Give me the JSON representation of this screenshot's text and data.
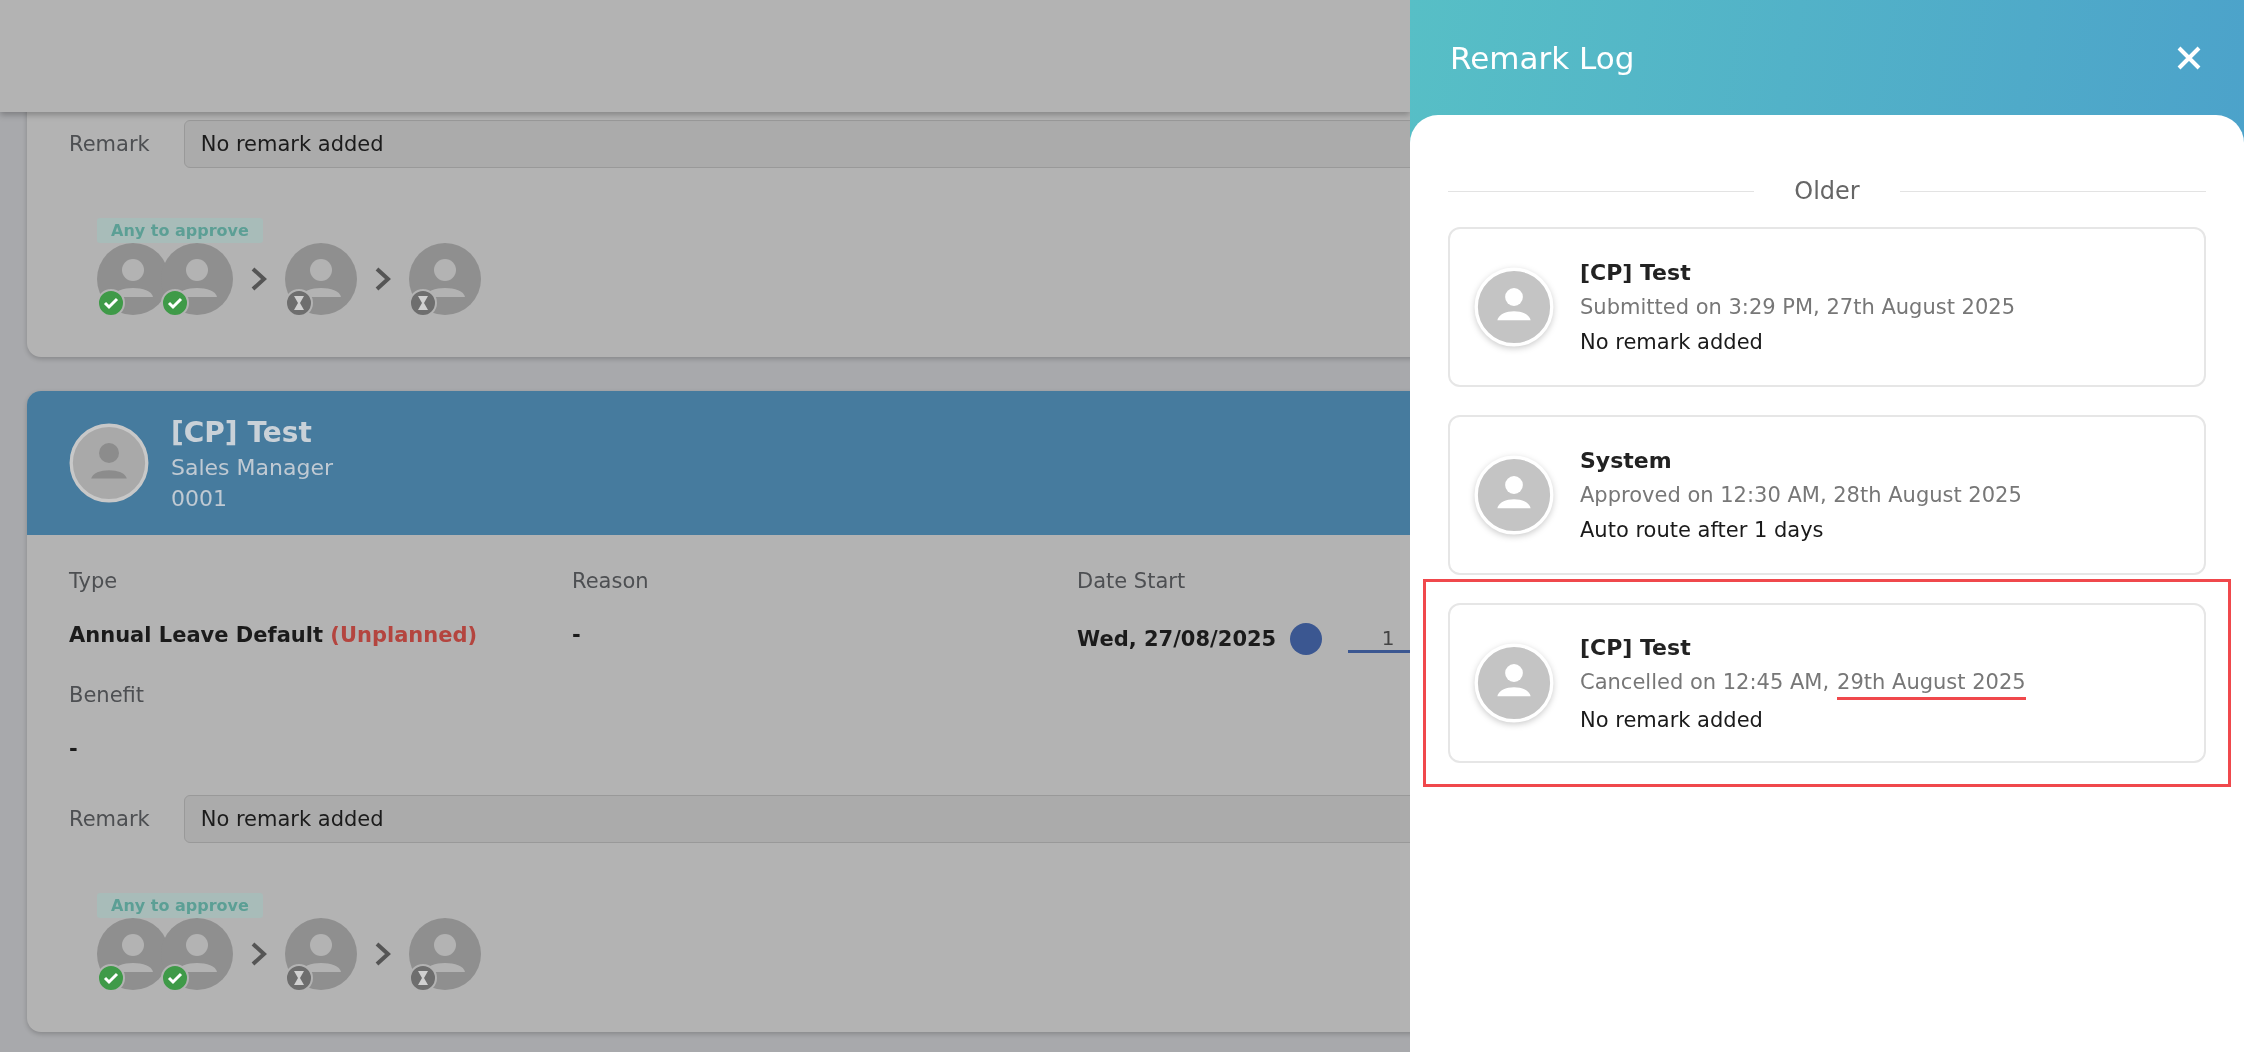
{
  "cards": [
    {
      "remark_label": "Remark",
      "remark_value": "No remark added",
      "approval_badge": "Any to approve",
      "approval_steps": [
        {
          "approvers": [
            {
              "approved": true
            },
            {
              "approved": true
            }
          ]
        },
        {
          "approvers": [
            {
              "approved": false
            }
          ]
        },
        {
          "approvers": [
            {
              "approved": false
            }
          ]
        }
      ]
    },
    {
      "name": "[CP] Test",
      "position": "Sales Manager",
      "code": "0001",
      "fields": [
        {
          "label": "Type",
          "value": "Annual Leave Default",
          "note": "(Unplanned)"
        },
        {
          "label": "Reason",
          "value": "-"
        },
        {
          "label": "Date Start",
          "value": "Wed, 27/08/2025",
          "timeline_label": "1"
        }
      ],
      "benefit_label": "Benefit",
      "benefit_value": "-",
      "remark_label": "Remark",
      "remark_value": "No remark added",
      "approval_badge": "Any to approve",
      "approval_steps": [
        {
          "approvers": [
            {
              "approved": true
            },
            {
              "approved": true
            }
          ]
        },
        {
          "approvers": [
            {
              "approved": false
            }
          ]
        },
        {
          "approvers": [
            {
              "approved": false
            }
          ]
        }
      ]
    }
  ],
  "drawer": {
    "title": "Remark Log",
    "divider": "Older",
    "entries": [
      {
        "name": "[CP] Test",
        "meta_parts": [
          {
            "text": "Submitted on 3:29 PM, 27th August 2025",
            "underlined": false
          }
        ],
        "remark": "No remark added",
        "highlighted": false
      },
      {
        "name": "System",
        "meta_parts": [
          {
            "text": "Approved on 12:30 AM, 28th August 2025",
            "underlined": false
          }
        ],
        "remark": "Auto route after 1 days",
        "highlighted": false
      },
      {
        "name": "[CP] Test",
        "meta_parts": [
          {
            "text": "Cancelled on 12:45 AM,",
            "underlined": false
          },
          {
            "text": "29th August 2025",
            "underlined": true
          }
        ],
        "remark": "No remark added",
        "highlighted": true
      }
    ]
  }
}
